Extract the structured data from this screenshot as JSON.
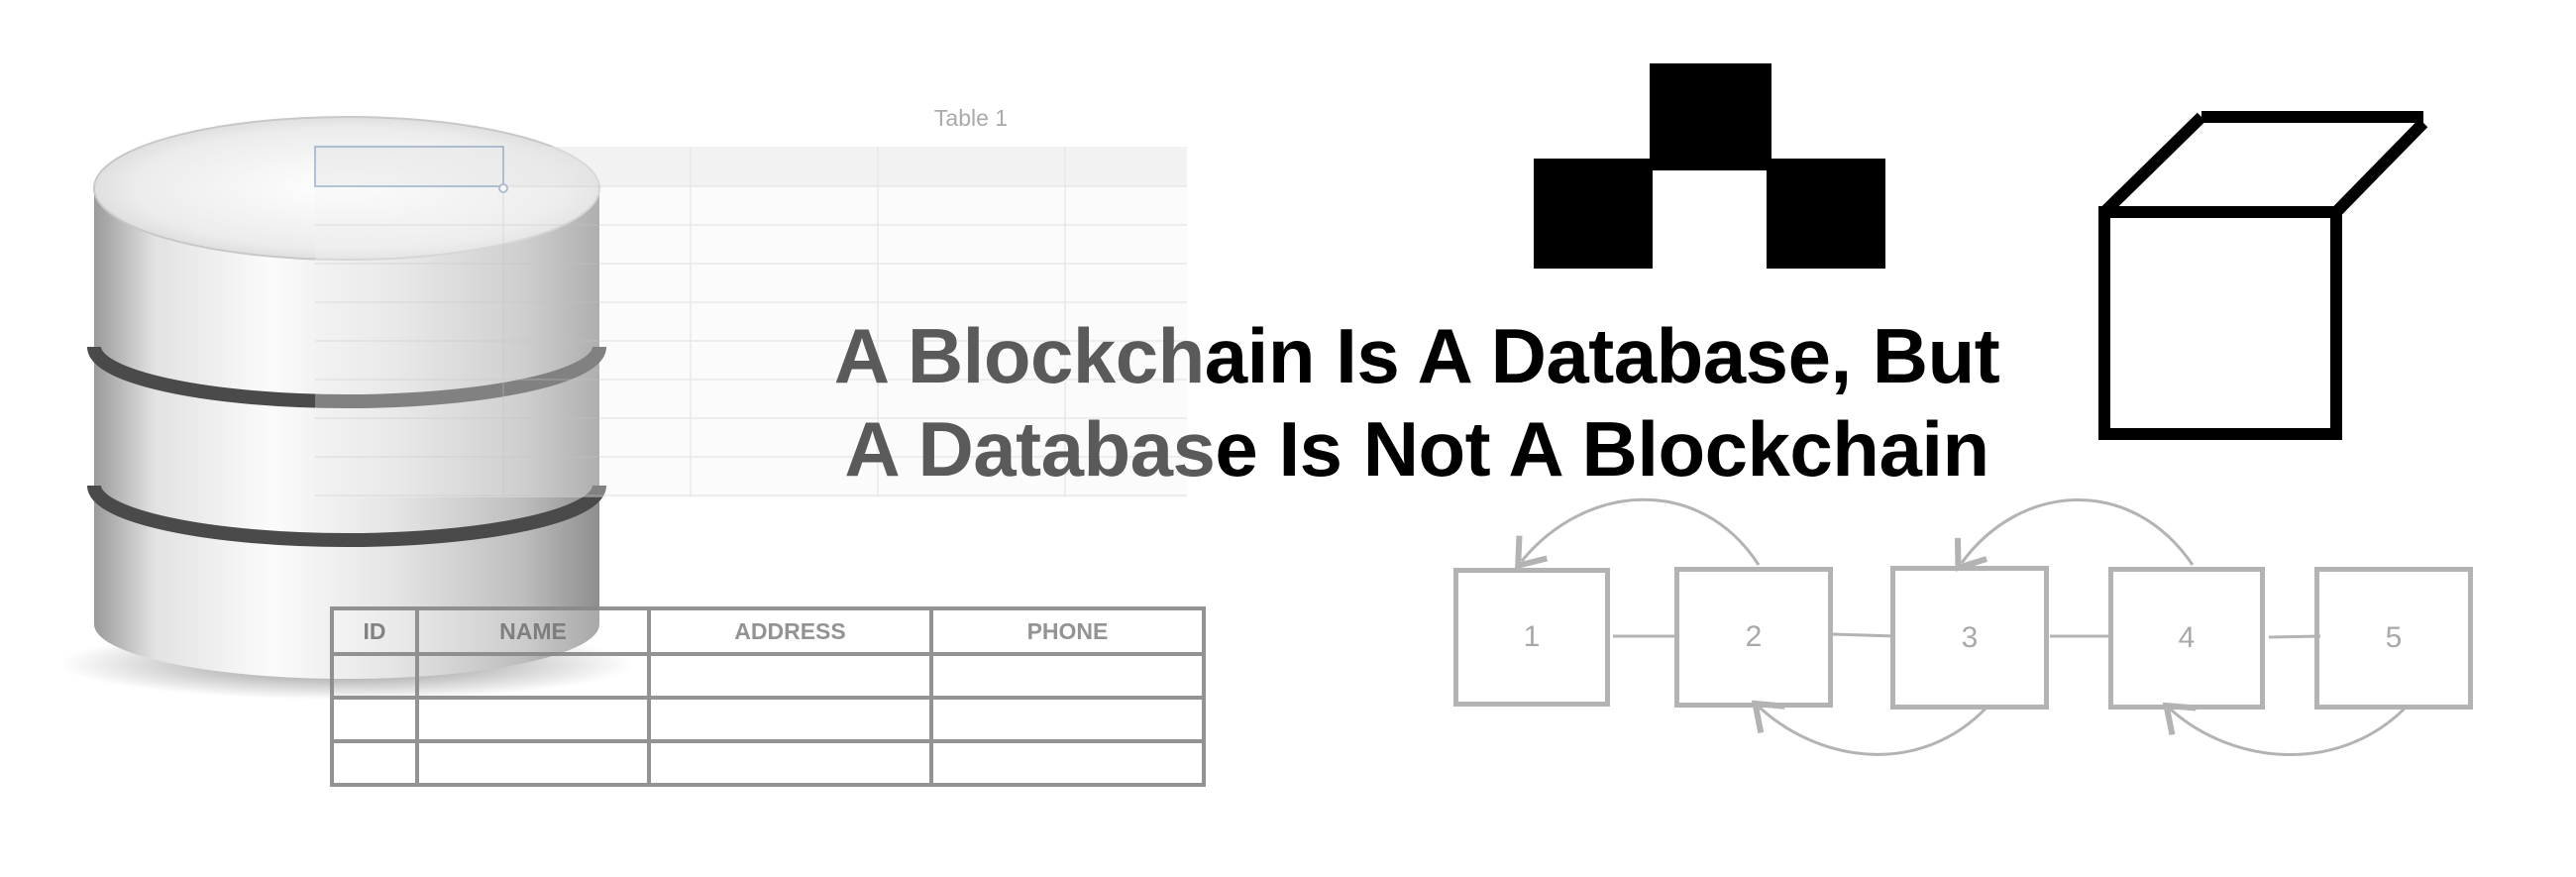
{
  "spreadsheet": {
    "title": "Table 1"
  },
  "table": {
    "headers": [
      "ID",
      "NAME",
      "ADDRESS",
      "PHONE"
    ],
    "rows": [
      [
        "",
        "",
        "",
        ""
      ],
      [
        "",
        "",
        "",
        ""
      ],
      [
        "",
        "",
        "",
        ""
      ]
    ]
  },
  "headline": {
    "line1_faded": "A Blockch",
    "line1_rest": "ain Is A Database, But",
    "line2_faded": "A Databas",
    "line2_rest": "e Is Not A Blockchain"
  },
  "chain": {
    "blocks": [
      "1",
      "2",
      "3",
      "4",
      "5"
    ]
  },
  "icons": {
    "database": "database-cylinder-icon",
    "pyramid": "pyramid-blocks-icon",
    "cube": "open-box-icon"
  },
  "colors": {
    "text": "#000000",
    "faded_text": "#5a5a5a",
    "line_gray": "#b3b3b3",
    "table_gray": "#8a8a8a"
  }
}
